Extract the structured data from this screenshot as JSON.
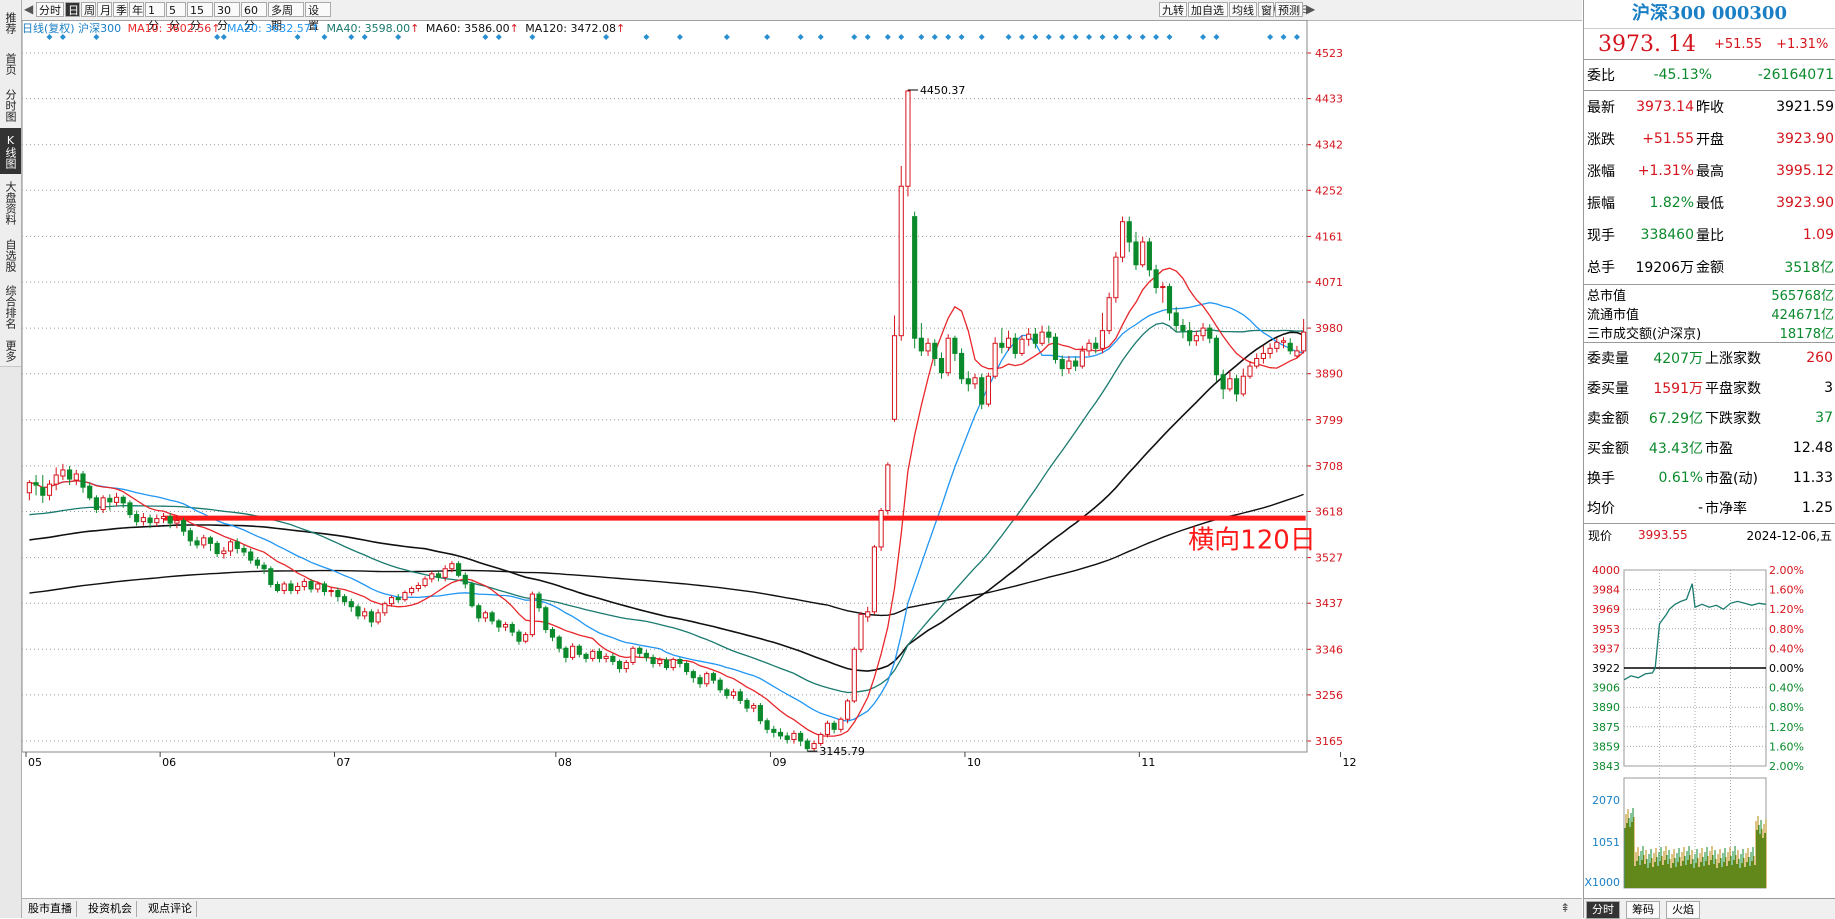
{
  "left_sidebar": [
    {
      "label": "推荐",
      "active": false
    },
    {
      "label": "首页",
      "active": false
    },
    {
      "label": "分时图",
      "active": false
    },
    {
      "label": "K线图",
      "active": true
    },
    {
      "label": "大盘资料",
      "active": false
    },
    {
      "label": "自选股",
      "active": false
    },
    {
      "label": "综合排名",
      "active": false
    },
    {
      "label": "更多",
      "active": false
    }
  ],
  "toolbar": {
    "periods": [
      "分时",
      "日",
      "周",
      "月",
      "季",
      "年",
      "1分",
      "5分",
      "15分",
      "30分",
      "60分",
      "多周期",
      "设置"
    ],
    "active_period": "日",
    "right_buttons": [
      "九转",
      "加自选",
      "均线",
      "窗",
      "预测"
    ]
  },
  "ma_line": {
    "prefix": "日线(复权)",
    "stock": "沪深300",
    "ma10": "MA10: 3602.56",
    "ma20": "MA20: 3632.57",
    "ma40": "MA40: 3598.00",
    "ma60": "MA60: 3586.00",
    "ma120": "MA120: 3472.08"
  },
  "colors": {
    "up": "#d4141c",
    "down": "#0b8a2c",
    "ma10": "#e8262a",
    "ma20": "#2196f3",
    "ma40": "#1a7a6e",
    "ma60": "#111111",
    "ma120": "#111111",
    "accent": "#1a7fc4"
  },
  "chart_data": {
    "type": "candlestick",
    "y_axis_ticks": [
      4523,
      4433,
      4342,
      4252,
      4161,
      4071,
      3980,
      3890,
      3799,
      3708,
      3618,
      3527,
      3437,
      3346,
      3256,
      3165
    ],
    "ylim": [
      3075,
      4550
    ],
    "x_axis_ticks": [
      "05",
      "06",
      "07",
      "08",
      "09",
      "10",
      "11",
      "12"
    ],
    "x_tick_index": [
      0,
      20,
      46,
      79,
      111,
      140,
      166,
      196
    ],
    "max_label": "4450.37",
    "min_label": "3145.79",
    "annotation": "横向120日",
    "horizontal_level": 3605,
    "candles": [
      [
        3655,
        3675,
        3640,
        3680
      ],
      [
        3675,
        3670,
        3650,
        3690
      ],
      [
        3665,
        3650,
        3635,
        3690
      ],
      [
        3650,
        3672,
        3640,
        3680
      ],
      [
        3672,
        3690,
        3660,
        3705
      ],
      [
        3688,
        3700,
        3680,
        3712
      ],
      [
        3700,
        3682,
        3670,
        3708
      ],
      [
        3680,
        3692,
        3670,
        3700
      ],
      [
        3692,
        3666,
        3655,
        3698
      ],
      [
        3668,
        3645,
        3640,
        3675
      ],
      [
        3645,
        3622,
        3615,
        3650
      ],
      [
        3622,
        3645,
        3615,
        3650
      ],
      [
        3644,
        3637,
        3620,
        3652
      ],
      [
        3636,
        3646,
        3628,
        3655
      ],
      [
        3646,
        3635,
        3625,
        3650
      ],
      [
        3635,
        3612,
        3605,
        3640
      ],
      [
        3612,
        3598,
        3590,
        3620
      ],
      [
        3598,
        3606,
        3590,
        3615
      ],
      [
        3605,
        3596,
        3585,
        3612
      ],
      [
        3596,
        3604,
        3588,
        3612
      ],
      [
        3604,
        3608,
        3595,
        3615
      ],
      [
        3608,
        3595,
        3585,
        3615
      ],
      [
        3595,
        3600,
        3585,
        3610
      ],
      [
        3600,
        3579,
        3570,
        3606
      ],
      [
        3580,
        3560,
        3550,
        3586
      ],
      [
        3560,
        3552,
        3545,
        3568
      ],
      [
        3552,
        3566,
        3545,
        3572
      ],
      [
        3566,
        3555,
        3540,
        3570
      ],
      [
        3555,
        3535,
        3528,
        3560
      ],
      [
        3535,
        3540,
        3525,
        3548
      ],
      [
        3540,
        3558,
        3530,
        3562
      ],
      [
        3558,
        3545,
        3535,
        3565
      ],
      [
        3545,
        3538,
        3530,
        3552
      ],
      [
        3538,
        3522,
        3515,
        3545
      ],
      [
        3522,
        3512,
        3505,
        3528
      ],
      [
        3512,
        3505,
        3495,
        3518
      ],
      [
        3505,
        3474,
        3468,
        3510
      ],
      [
        3474,
        3462,
        3458,
        3480
      ],
      [
        3462,
        3475,
        3455,
        3480
      ],
      [
        3475,
        3462,
        3455,
        3482
      ],
      [
        3462,
        3470,
        3455,
        3478
      ],
      [
        3470,
        3480,
        3462,
        3486
      ],
      [
        3480,
        3465,
        3458,
        3485
      ],
      [
        3465,
        3475,
        3458,
        3480
      ],
      [
        3475,
        3460,
        3452,
        3480
      ],
      [
        3460,
        3462,
        3450,
        3468
      ],
      [
        3462,
        3450,
        3440,
        3468
      ],
      [
        3450,
        3440,
        3432,
        3455
      ],
      [
        3440,
        3430,
        3420,
        3446
      ],
      [
        3430,
        3412,
        3405,
        3435
      ],
      [
        3412,
        3420,
        3405,
        3428
      ],
      [
        3420,
        3400,
        3390,
        3425
      ],
      [
        3400,
        3418,
        3395,
        3425
      ],
      [
        3418,
        3436,
        3412,
        3440
      ],
      [
        3436,
        3448,
        3430,
        3452
      ],
      [
        3448,
        3444,
        3438,
        3455
      ],
      [
        3444,
        3458,
        3440,
        3462
      ],
      [
        3458,
        3466,
        3452,
        3470
      ],
      [
        3466,
        3472,
        3460,
        3478
      ],
      [
        3472,
        3485,
        3468,
        3490
      ],
      [
        3485,
        3495,
        3478,
        3500
      ],
      [
        3495,
        3488,
        3480,
        3500
      ],
      [
        3488,
        3505,
        3480,
        3512
      ],
      [
        3505,
        3515,
        3498,
        3520
      ],
      [
        3515,
        3492,
        3488,
        3520
      ],
      [
        3492,
        3475,
        3466,
        3498
      ],
      [
        3475,
        3432,
        3428,
        3480
      ],
      [
        3432,
        3408,
        3400,
        3436
      ],
      [
        3408,
        3418,
        3400,
        3422
      ],
      [
        3418,
        3402,
        3395,
        3422
      ],
      [
        3402,
        3390,
        3380,
        3406
      ],
      [
        3390,
        3395,
        3382,
        3400
      ],
      [
        3395,
        3380,
        3372,
        3400
      ],
      [
        3380,
        3362,
        3355,
        3385
      ],
      [
        3362,
        3375,
        3358,
        3380
      ],
      [
        3375,
        3455,
        3370,
        3460
      ],
      [
        3455,
        3428,
        3420,
        3460
      ],
      [
        3428,
        3385,
        3378,
        3432
      ],
      [
        3385,
        3370,
        3362,
        3390
      ],
      [
        3370,
        3348,
        3340,
        3374
      ],
      [
        3348,
        3330,
        3320,
        3352
      ],
      [
        3330,
        3352,
        3325,
        3358
      ],
      [
        3352,
        3336,
        3330,
        3356
      ],
      [
        3336,
        3328,
        3320,
        3340
      ],
      [
        3328,
        3342,
        3322,
        3346
      ],
      [
        3342,
        3328,
        3320,
        3348
      ],
      [
        3328,
        3332,
        3320,
        3338
      ],
      [
        3332,
        3322,
        3315,
        3338
      ],
      [
        3322,
        3308,
        3300,
        3326
      ],
      [
        3308,
        3320,
        3300,
        3325
      ],
      [
        3320,
        3348,
        3315,
        3352
      ],
      [
        3348,
        3338,
        3330,
        3352
      ],
      [
        3338,
        3330,
        3322,
        3345
      ],
      [
        3330,
        3318,
        3310,
        3336
      ],
      [
        3318,
        3325,
        3312,
        3330
      ],
      [
        3325,
        3310,
        3305,
        3330
      ],
      [
        3310,
        3326,
        3304,
        3330
      ],
      [
        3326,
        3318,
        3310,
        3330
      ],
      [
        3318,
        3302,
        3295,
        3322
      ],
      [
        3302,
        3290,
        3280,
        3306
      ],
      [
        3290,
        3278,
        3270,
        3296
      ],
      [
        3278,
        3298,
        3272,
        3302
      ],
      [
        3298,
        3285,
        3278,
        3302
      ],
      [
        3285,
        3266,
        3260,
        3290
      ],
      [
        3266,
        3255,
        3248,
        3270
      ],
      [
        3255,
        3262,
        3248,
        3268
      ],
      [
        3262,
        3245,
        3238,
        3268
      ],
      [
        3245,
        3230,
        3222,
        3250
      ],
      [
        3230,
        3235,
        3222,
        3240
      ],
      [
        3235,
        3205,
        3198,
        3240
      ],
      [
        3205,
        3188,
        3180,
        3210
      ],
      [
        3188,
        3182,
        3172,
        3195
      ],
      [
        3182,
        3175,
        3168,
        3190
      ],
      [
        3175,
        3168,
        3160,
        3182
      ],
      [
        3168,
        3180,
        3160,
        3186
      ],
      [
        3180,
        3165,
        3155,
        3185
      ],
      [
        3165,
        3150,
        3145,
        3170
      ],
      [
        3150,
        3160,
        3146,
        3166
      ],
      [
        3160,
        3178,
        3155,
        3182
      ],
      [
        3178,
        3200,
        3172,
        3205
      ],
      [
        3200,
        3188,
        3180,
        3205
      ],
      [
        3188,
        3208,
        3182,
        3212
      ],
      [
        3208,
        3244,
        3200,
        3248
      ],
      [
        3244,
        3346,
        3240,
        3350
      ],
      [
        3346,
        3415,
        3340,
        3420
      ],
      [
        3410,
        3420,
        3400,
        3430
      ],
      [
        3420,
        3548,
        3415,
        3552
      ],
      [
        3548,
        3620,
        3540,
        3625
      ],
      [
        3620,
        3710,
        3612,
        3715
      ],
      [
        3800,
        3965,
        3795,
        4005
      ],
      [
        3965,
        4260,
        3955,
        4300
      ],
      [
        4260,
        4448,
        4240,
        4450
      ],
      [
        4200,
        3960,
        3940,
        4210
      ],
      [
        3960,
        3935,
        3925,
        3990
      ],
      [
        3935,
        3950,
        3925,
        3960
      ],
      [
        3950,
        3920,
        3905,
        3958
      ],
      [
        3920,
        3892,
        3880,
        3932
      ],
      [
        3892,
        3960,
        3885,
        3968
      ],
      [
        3960,
        3930,
        3915,
        3965
      ],
      [
        3930,
        3880,
        3870,
        3940
      ],
      [
        3880,
        3870,
        3855,
        3895
      ],
      [
        3870,
        3882,
        3860,
        3890
      ],
      [
        3882,
        3830,
        3820,
        3890
      ],
      [
        3830,
        3885,
        3825,
        3892
      ],
      [
        3885,
        3950,
        3880,
        3962
      ],
      [
        3950,
        3942,
        3930,
        3980
      ],
      [
        3942,
        3960,
        3935,
        3975
      ],
      [
        3960,
        3930,
        3920,
        3970
      ],
      [
        3930,
        3958,
        3925,
        3966
      ],
      [
        3958,
        3968,
        3945,
        3980
      ],
      [
        3968,
        3950,
        3940,
        3980
      ],
      [
        3950,
        3972,
        3945,
        3985
      ],
      [
        3972,
        3962,
        3950,
        3985
      ],
      [
        3962,
        3918,
        3910,
        3970
      ],
      [
        3918,
        3900,
        3885,
        3926
      ],
      [
        3900,
        3915,
        3890,
        3925
      ],
      [
        3915,
        3905,
        3895,
        3922
      ],
      [
        3905,
        3935,
        3900,
        3945
      ],
      [
        3935,
        3950,
        3925,
        3958
      ],
      [
        3950,
        3940,
        3930,
        3962
      ],
      [
        3940,
        3975,
        3930,
        4010
      ],
      [
        3975,
        4040,
        3968,
        4050
      ],
      [
        4040,
        4120,
        4030,
        4130
      ],
      [
        4120,
        4190,
        4110,
        4200
      ],
      [
        4190,
        4150,
        4130,
        4200
      ],
      [
        4150,
        4105,
        4095,
        4170
      ],
      [
        4105,
        4150,
        4100,
        4160
      ],
      [
        4150,
        4095,
        4082,
        4158
      ],
      [
        4095,
        4060,
        4048,
        4105
      ],
      [
        4060,
        4062,
        4030,
        4070
      ],
      [
        4062,
        4010,
        3995,
        4068
      ],
      [
        4010,
        3985,
        3972,
        4022
      ],
      [
        3985,
        3975,
        3960,
        3998
      ],
      [
        3975,
        3955,
        3945,
        3992
      ],
      [
        3955,
        3965,
        3945,
        3975
      ],
      [
        3965,
        3980,
        3955,
        3990
      ],
      [
        3980,
        3960,
        3950,
        3988
      ],
      [
        3960,
        3888,
        3875,
        3966
      ],
      [
        3888,
        3860,
        3840,
        3898
      ],
      [
        3860,
        3880,
        3855,
        3895
      ],
      [
        3880,
        3850,
        3835,
        3888
      ],
      [
        3850,
        3885,
        3845,
        3900
      ],
      [
        3885,
        3905,
        3880,
        3915
      ],
      [
        3905,
        3920,
        3900,
        3930
      ],
      [
        3920,
        3930,
        3910,
        3945
      ],
      [
        3930,
        3940,
        3920,
        3950
      ],
      [
        3940,
        3952,
        3932,
        3960
      ],
      [
        3952,
        3955,
        3940,
        3962
      ],
      [
        3950,
        3935,
        3928,
        3960
      ],
      [
        3925,
        3935,
        3920,
        3945
      ],
      [
        3935,
        3972,
        3930,
        3998
      ]
    ]
  },
  "right_panel": {
    "title": "沪深300 000300",
    "price": "3973. 14",
    "change": "+51.55",
    "change_pct": "+1.31%",
    "weibi": {
      "label": "委比",
      "v1": "-45.13%",
      "v2": "-26164071"
    },
    "quote_rows": [
      {
        "l1": "最新",
        "v1": "3973.14",
        "l2": "昨收",
        "v2": "3921.59",
        "c1": "red",
        "c2": "blk"
      },
      {
        "l1": "涨跌",
        "v1": "+51.55",
        "l2": "开盘",
        "v2": "3923.90",
        "c1": "red",
        "c2": "red"
      },
      {
        "l1": "涨幅",
        "v1": "+1.31%",
        "l2": "最高",
        "v2": "3995.12",
        "c1": "red",
        "c2": "red"
      },
      {
        "l1": "振幅",
        "v1": "1.82%",
        "l2": "最低",
        "v2": "3923.90",
        "c1": "green",
        "c2": "red"
      },
      {
        "l1": "现手",
        "v1": "338460",
        "l2": "量比",
        "v2": "1.09",
        "c1": "green",
        "c2": "red"
      },
      {
        "l1": "总手",
        "v1": "19206万",
        "l2": "金额",
        "v2": "3518亿",
        "c1": "blk",
        "c2": "green"
      }
    ],
    "market_rows": [
      {
        "l": "总市值",
        "v": "565768亿"
      },
      {
        "l": "流通市值",
        "v": "424671亿"
      },
      {
        "l": "三市成交额(沪深京)",
        "v": "18178亿"
      }
    ],
    "stat_rows": [
      {
        "l1": "委卖量",
        "v1": "4207万",
        "l2": "上涨家数",
        "v2": "260",
        "c1": "green",
        "c2": "red"
      },
      {
        "l1": "委买量",
        "v1": "1591万",
        "l2": "平盘家数",
        "v2": "3",
        "c1": "red",
        "c2": "blk"
      },
      {
        "l1": "卖金额",
        "v1": "67.29亿",
        "l2": "下跌家数",
        "v2": "37",
        "c1": "green",
        "c2": "green"
      },
      {
        "l1": "买金额",
        "v1": "43.43亿",
        "l2": "市盈",
        "v2": "12.48",
        "c1": "green",
        "c2": "blk"
      },
      {
        "l1": "换手",
        "v1": "0.61%",
        "l2": "市盈(动)",
        "v2": "11.33",
        "c1": "green",
        "c2": "blk"
      },
      {
        "l1": "均价",
        "v1": "-",
        "l2": "市净率",
        "v2": "1.25",
        "c1": "blk",
        "c2": "blk"
      }
    ],
    "now_label": "现价",
    "now_price": "3993.55",
    "date": "2024-12-06,五",
    "mini_left_ticks": [
      "4000",
      "3984",
      "3969",
      "3953",
      "3937",
      "3922",
      "3906",
      "3890",
      "3875",
      "3859",
      "3843"
    ],
    "mini_right_ticks": [
      "2.00%",
      "1.60%",
      "1.20%",
      "0.80%",
      "0.40%",
      "0.00%",
      "0.40%",
      "0.80%",
      "1.20%",
      "1.60%",
      "2.00%"
    ],
    "vol_ticks": [
      "2070",
      "1051",
      "X1000"
    ],
    "tabs": [
      "分时",
      "筹码",
      "火焰"
    ]
  },
  "bottom_bar": [
    "股市直播",
    "投资机会",
    "观点评论"
  ]
}
